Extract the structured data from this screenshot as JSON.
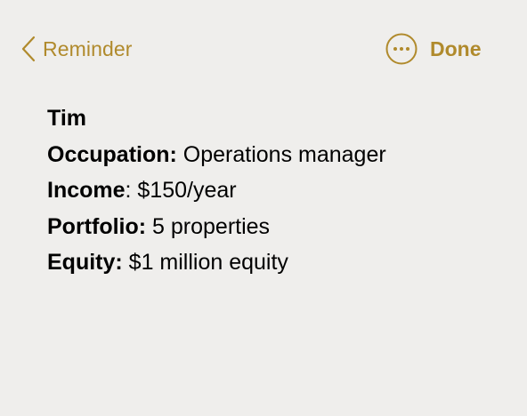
{
  "colors": {
    "background": "#efeeec",
    "accent": "#b08a2c",
    "text": "#000000"
  },
  "nav": {
    "back_icon": "chevron-left-icon",
    "back_label": "Reminder",
    "more_icon": "ellipsis-circle-icon",
    "done_label": "Done"
  },
  "note": {
    "title": "Tim",
    "lines": [
      {
        "key": "Occupation:",
        "sep": "",
        "value": " Operations manager"
      },
      {
        "key": "Income",
        "sep": ":",
        "value": " $150/year"
      },
      {
        "key": "Portfolio:",
        "sep": "",
        "value": " 5 properties"
      },
      {
        "key": "Equity:",
        "sep": "",
        "value": " $1 million equity"
      }
    ]
  }
}
